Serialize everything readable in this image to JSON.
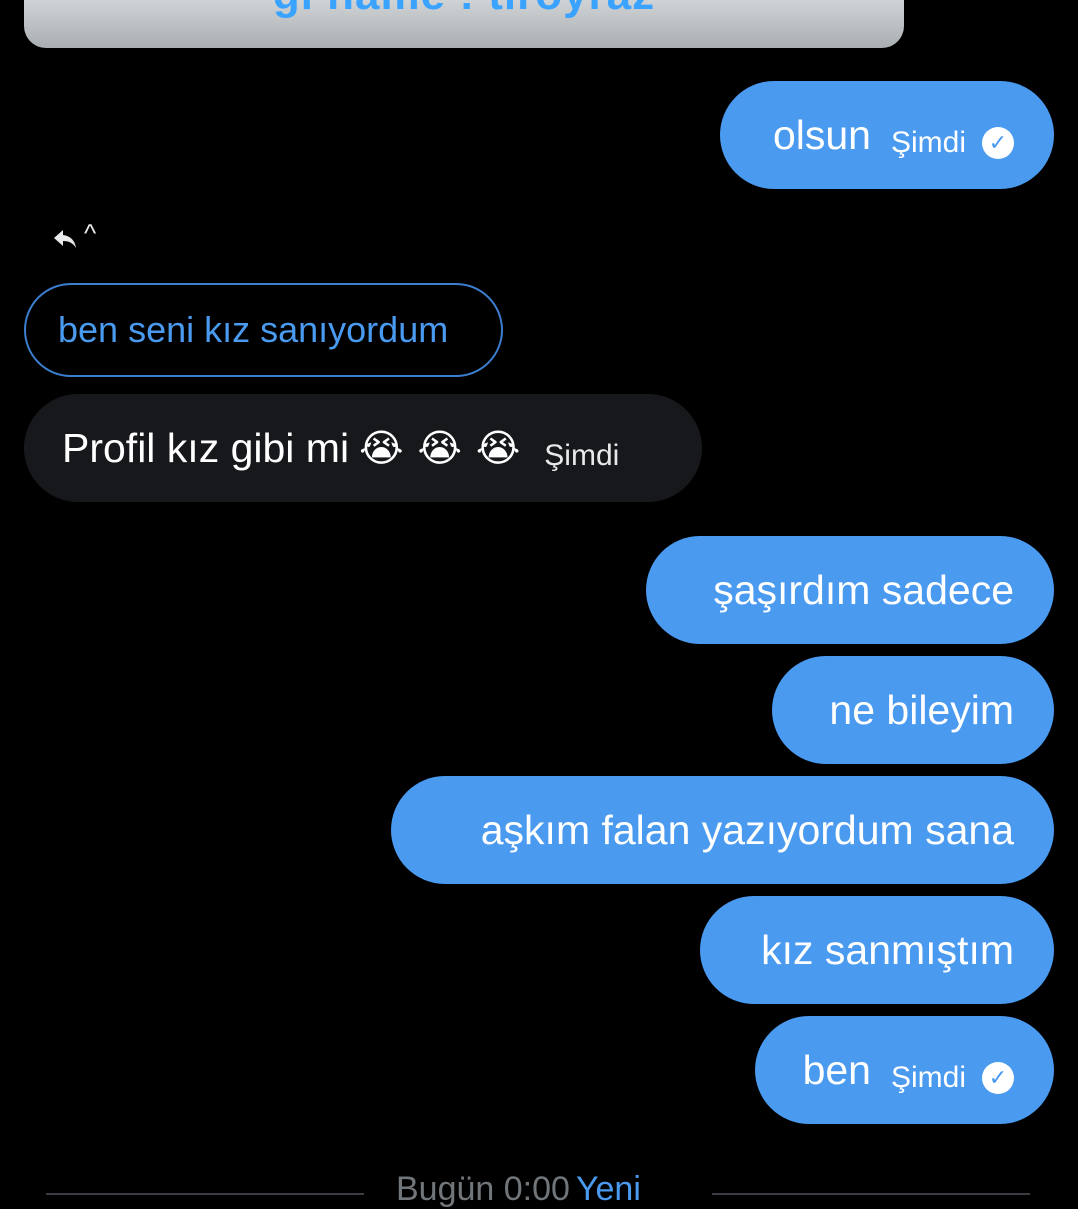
{
  "top_image": {
    "caption": "gi name : tiroyraz"
  },
  "messages": {
    "m1": {
      "text": "olsun",
      "time": "Şimdi"
    },
    "reply": {
      "quoted": "ben seni kız sanıyordum"
    },
    "m2": {
      "text": "Profil kız gibi mi",
      "emoji": "😭",
      "time": "Şimdi"
    },
    "m3": {
      "text": "şaşırdım sadece"
    },
    "m4": {
      "text": "ne bileyim"
    },
    "m5": {
      "text": "aşkım falan yazıyordum sana"
    },
    "m6": {
      "text": "kız sanmıştım"
    },
    "m7": {
      "text": "ben",
      "time": "Şimdi"
    }
  },
  "divider": {
    "label": "Bugün 0:00",
    "new_label": "Yeni"
  },
  "icons": {
    "reply": "reply-arrow-icon",
    "caret": "caret-up-icon",
    "read": "check-circle-icon"
  },
  "colors": {
    "background": "#000000",
    "sent_bubble": "#4a9af0",
    "received_bubble": "#16181c",
    "accent": "#4a9af0"
  }
}
